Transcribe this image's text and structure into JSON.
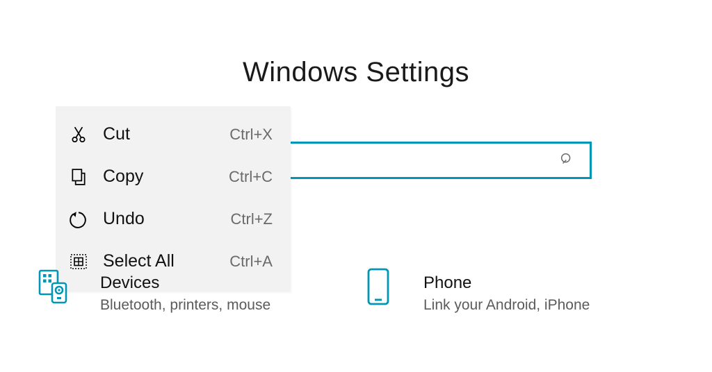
{
  "header": {
    "title": "Windows Settings"
  },
  "search": {
    "placeholder": ""
  },
  "context_menu": {
    "items": [
      {
        "id": "cut",
        "label": "Cut",
        "shortcut": "Ctrl+X",
        "icon": "cut-icon"
      },
      {
        "id": "copy",
        "label": "Copy",
        "shortcut": "Ctrl+C",
        "icon": "copy-icon"
      },
      {
        "id": "undo",
        "label": "Undo",
        "shortcut": "Ctrl+Z",
        "icon": "undo-icon"
      },
      {
        "id": "select_all",
        "label": "Select All",
        "shortcut": "Ctrl+A",
        "icon": "select-all-icon"
      }
    ]
  },
  "tiles": [
    {
      "id": "devices",
      "title": "Devices",
      "subtitle": "Bluetooth, printers, mouse",
      "icon": "devices-icon"
    },
    {
      "id": "phone",
      "title": "Phone",
      "subtitle": "Link your Android, iPhone",
      "icon": "phone-icon"
    }
  ],
  "colors": {
    "accent": "#0096b4"
  }
}
